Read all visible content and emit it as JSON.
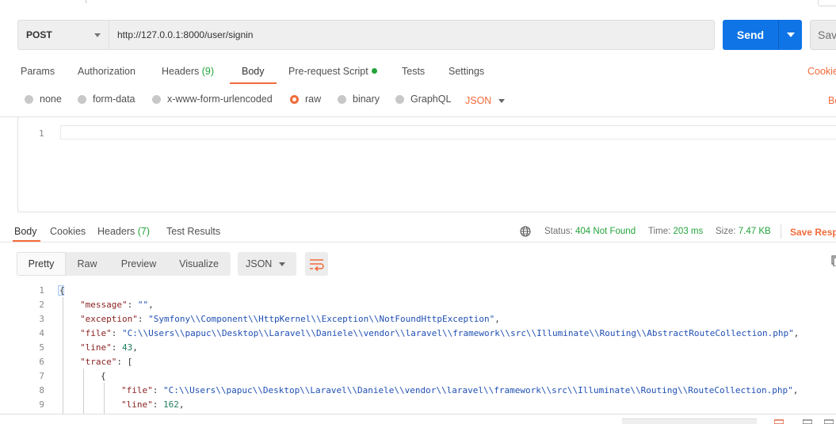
{
  "request": {
    "method": "POST",
    "url": "http://127.0.0.1:8000/user/signin",
    "send_label": "Send",
    "save_label": "Save"
  },
  "request_tabs": [
    {
      "label": "Params"
    },
    {
      "label": "Authorization"
    },
    {
      "label": "Headers",
      "count": "(9)"
    },
    {
      "label": "Body"
    },
    {
      "label": "Pre-request Script"
    },
    {
      "label": "Tests"
    },
    {
      "label": "Settings"
    }
  ],
  "cookies_link": "Cookies",
  "body_types": [
    "none",
    "form-data",
    "x-www-form-urlencoded",
    "raw",
    "binary",
    "GraphQL"
  ],
  "body_format": "JSON",
  "beautify_link": "Beautify",
  "request_editor": {
    "line_number": "1"
  },
  "response_tabs": [
    {
      "label": "Body"
    },
    {
      "label": "Cookies"
    },
    {
      "label": "Headers",
      "count": "(7)"
    },
    {
      "label": "Test Results"
    }
  ],
  "status": {
    "status_label": "Status:",
    "status_value": "404 Not Found",
    "time_label": "Time:",
    "time_value": "203 ms",
    "size_label": "Size:",
    "size_value": "7.47 KB",
    "save_response": "Save Response"
  },
  "view_modes": [
    "Pretty",
    "Raw",
    "Preview",
    "Visualize"
  ],
  "response_format": "JSON",
  "response_lines": [
    {
      "n": "1",
      "key": "",
      "value": "",
      "text": "{"
    },
    {
      "n": "2",
      "key": "\"message\"",
      "value": "\"\"",
      "tail": ","
    },
    {
      "n": "3",
      "key": "\"exception\"",
      "value": "\"Symfony\\\\Component\\\\HttpKernel\\\\Exception\\\\NotFoundHttpException\"",
      "tail": ","
    },
    {
      "n": "4",
      "key": "\"file\"",
      "value": "\"C:\\\\Users\\\\papuc\\\\Desktop\\\\Laravel\\\\Daniele\\\\vendor\\\\laravel\\\\framework\\\\src\\\\Illuminate\\\\Routing\\\\AbstractRouteCollection.php\"",
      "tail": ","
    },
    {
      "n": "5",
      "key": "\"line\"",
      "value": "43",
      "tail": ","
    },
    {
      "n": "6",
      "key": "\"trace\"",
      "value": "",
      "tail": "["
    },
    {
      "n": "7",
      "key": "",
      "value": "",
      "text": "{"
    },
    {
      "n": "8",
      "key": "\"file\"",
      "value": "\"C:\\\\Users\\\\papuc\\\\Desktop\\\\Laravel\\\\Daniele\\\\vendor\\\\laravel\\\\framework\\\\src\\\\Illuminate\\\\Routing\\\\RouteCollection.php\"",
      "tail": ","
    },
    {
      "n": "9",
      "key": "\"line\"",
      "value": "162",
      "tail": ","
    }
  ],
  "colors": {
    "accent": "#f26b3a",
    "send": "#0f74e6",
    "success": "#23a33b"
  }
}
